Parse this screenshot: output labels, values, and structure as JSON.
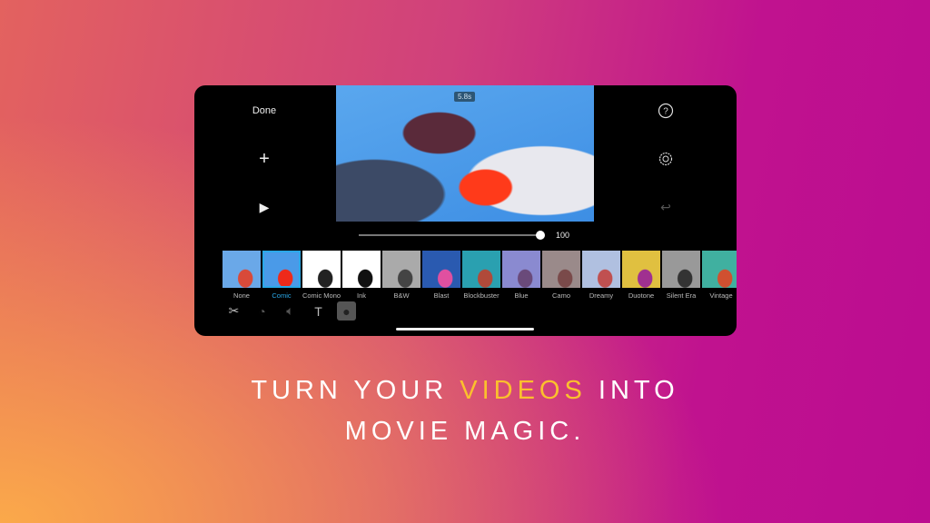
{
  "editor": {
    "done_label": "Done",
    "add_icon": "plus-icon",
    "play_icon": "play-icon",
    "help_icon": "question-circle-icon",
    "settings_icon": "gear-icon",
    "undo_icon": "undo-icon",
    "clip_duration": "5.8s",
    "filter_intensity": "100",
    "filters": [
      {
        "label": "None",
        "colors": [
          "#6aa8e8",
          "#d84a3a"
        ]
      },
      {
        "label": "Comic",
        "colors": [
          "#4a9ae8",
          "#ee2a1a"
        ],
        "selected": true
      },
      {
        "label": "Comic Mono",
        "colors": [
          "#ffffff",
          "#222222"
        ]
      },
      {
        "label": "Ink",
        "colors": [
          "#ffffff",
          "#111111"
        ]
      },
      {
        "label": "B&W",
        "colors": [
          "#aaaaaa",
          "#444444"
        ]
      },
      {
        "label": "Blast",
        "colors": [
          "#2a5ab0",
          "#e050a0"
        ]
      },
      {
        "label": "Blockbuster",
        "colors": [
          "#2aa0b0",
          "#b04a3a"
        ]
      },
      {
        "label": "Blue",
        "colors": [
          "#8a8ad0",
          "#6a4a7a"
        ]
      },
      {
        "label": "Camo",
        "colors": [
          "#9a8a8a",
          "#7a4a4a"
        ]
      },
      {
        "label": "Dreamy",
        "colors": [
          "#b0c0e0",
          "#c05050"
        ]
      },
      {
        "label": "Duotone",
        "colors": [
          "#e0c040",
          "#a03090"
        ]
      },
      {
        "label": "Silent Era",
        "colors": [
          "#999999",
          "#333333"
        ]
      },
      {
        "label": "Vintage",
        "colors": [
          "#40b0a0",
          "#d05030"
        ]
      }
    ],
    "tools": [
      {
        "name": "scissors-icon",
        "glyph": "✂",
        "state": "normal"
      },
      {
        "name": "speed-gauge-icon",
        "glyph": "◔",
        "state": "dim"
      },
      {
        "name": "volume-icon",
        "glyph": "🔈︎",
        "state": "dim"
      },
      {
        "name": "text-icon",
        "glyph": "T",
        "state": "normal"
      },
      {
        "name": "filters-icon",
        "glyph": "●",
        "state": "active"
      }
    ]
  },
  "tagline": {
    "line1_before": "TURN YOUR ",
    "line1_highlight": "VIDEOS",
    "line1_after": " INTO",
    "line2": "MOVIE MAGIC.",
    "highlight_color": "#fbc02d"
  }
}
